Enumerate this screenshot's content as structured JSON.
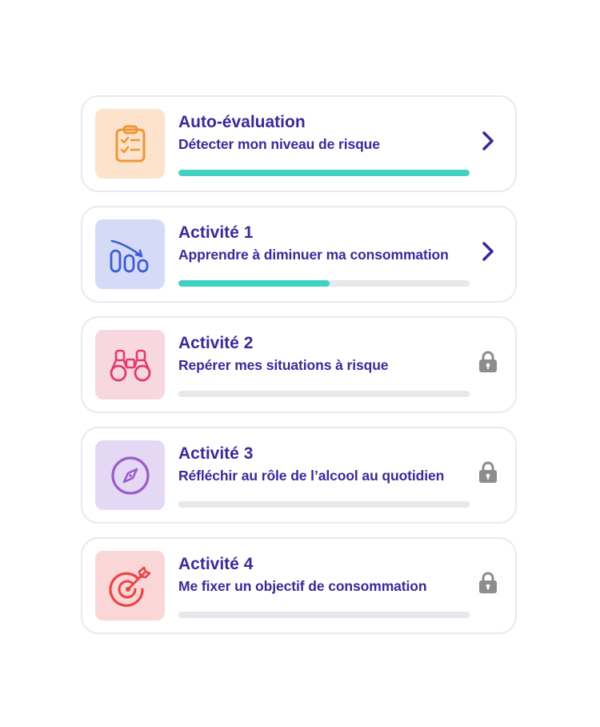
{
  "colors": {
    "title": "#3a2a9a",
    "progress": "#3fd1c1",
    "track": "#e8e8ec",
    "chevron": "#3a2a9a",
    "lock": "#8c8c8c"
  },
  "activities": [
    {
      "title": "Auto-évaluation",
      "subtitle": "Détecter mon niveau de risque",
      "icon": "clipboard-checklist-icon",
      "tile_color": "#fde3cb",
      "icon_color": "#f0963a",
      "progress": 1.0,
      "locked": false
    },
    {
      "title": "Activité 1",
      "subtitle": "Apprendre à diminuer ma consommation",
      "icon": "decreasing-bottles-icon",
      "tile_color": "#d5dbf7",
      "icon_color": "#3d5bd6",
      "progress": 0.52,
      "locked": false
    },
    {
      "title": "Activité 2",
      "subtitle": "Repérer mes situations à risque",
      "icon": "binoculars-icon",
      "tile_color": "#f7d7e0",
      "icon_color": "#e23b6b",
      "progress": 0,
      "locked": true
    },
    {
      "title": "Activité 3",
      "subtitle": "Réfléchir au rôle de l’alcool au quotidien",
      "icon": "compass-icon",
      "tile_color": "#e5d8f5",
      "icon_color": "#9a5cc6",
      "progress": 0,
      "locked": true
    },
    {
      "title": "Activité 4",
      "subtitle": "Me fixer un objectif de consommation",
      "icon": "target-arrow-icon",
      "tile_color": "#fbd6d6",
      "icon_color": "#e84545",
      "progress": 0,
      "locked": true
    }
  ]
}
